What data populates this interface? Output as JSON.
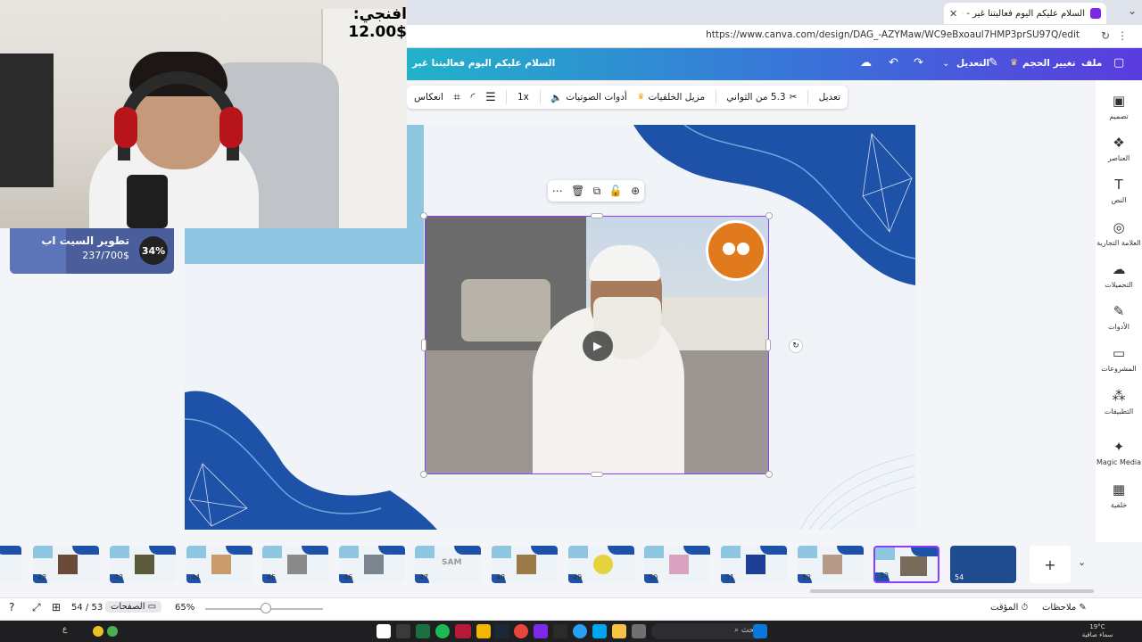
{
  "browser": {
    "tab_title": "السلام عليكم اليوم فعاليتنا غير - عرض...",
    "url": "https://www.canva.com/design/DAG_-AZYMaw/WC9eBxoaul7HMP3prSU97Q/edit"
  },
  "header": {
    "doc_title": "السلام عليكم اليوم فعاليتنا غير",
    "file": "ملف",
    "resize": "تغيير الحجم",
    "editing": "التعديل"
  },
  "webcam": {
    "price_label": "افنجي: $12.00"
  },
  "goal": {
    "percent": "34%",
    "percent_value": 34,
    "name": "تطوير السيت اب",
    "amount": "237/700$"
  },
  "toolbar": {
    "edit": "تعديل",
    "duration": "5.3 من الثواني",
    "bg_remover": "مزيل الخلفيات",
    "audio_tools": "أدوات الصوتيات",
    "speed": "1x",
    "flip": "انعكاس"
  },
  "sidebar": {
    "items": [
      {
        "label": "تصميم",
        "icon": "design-icon"
      },
      {
        "label": "العناصر",
        "icon": "elements-icon"
      },
      {
        "label": "النص",
        "icon": "text-icon"
      },
      {
        "label": "العلامة التجارية",
        "icon": "brand-icon"
      },
      {
        "label": "التحميلات",
        "icon": "upload-icon"
      },
      {
        "label": "الأدوات",
        "icon": "draw-icon"
      },
      {
        "label": "المشروعات",
        "icon": "folder-icon"
      },
      {
        "label": "التطبيقات",
        "icon": "apps-icon"
      },
      {
        "label": "Magic Media",
        "icon": "magic-media-icon"
      },
      {
        "label": "خلفية",
        "icon": "background-icon"
      }
    ]
  },
  "filmstrip": {
    "pages": [
      "42",
      "43",
      "44",
      "45",
      "46",
      "47",
      "48",
      "49",
      "50",
      "51",
      "52",
      "53",
      "54"
    ],
    "thumb_text_47": "SAM"
  },
  "bottombar": {
    "notes": "ملاحظات",
    "timer": "المؤقت",
    "zoom": "65%",
    "pages": "الصفحات",
    "page_counter": "54 / 53"
  },
  "taskbar": {
    "search_placeholder": "بحث",
    "weather": "19°C",
    "weather_desc": "سماء صافية"
  },
  "colors": {
    "accent": "#8b3dff",
    "header_start": "#22b2c9",
    "header_end": "#5a3bde",
    "wave": "#1e52a8"
  }
}
